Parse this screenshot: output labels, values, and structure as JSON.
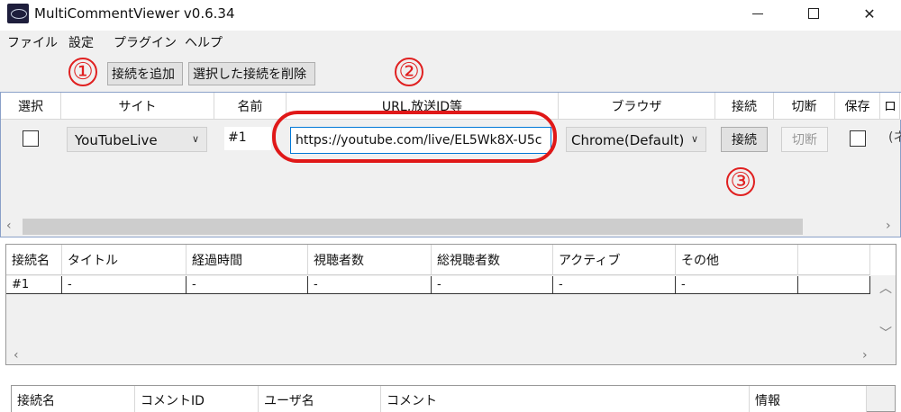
{
  "window": {
    "title": "MultiCommentViewer v0.6.34",
    "controls": {
      "minimize": "—",
      "maximize": "☐",
      "close": "✕"
    }
  },
  "menu": [
    "ファイル",
    "設定",
    "プラグイン",
    "ヘルプ"
  ],
  "toolbar": {
    "add_connection": "接続を追加",
    "delete_connection": "選択した接続を削除"
  },
  "annotations": [
    "①",
    "②",
    "③"
  ],
  "connections": {
    "headers": [
      "選択",
      "サイト",
      "名前",
      "URL,放送ID等",
      "ブラウザ",
      "接続",
      "切断",
      "保存",
      "ロ"
    ],
    "row": {
      "site": "YouTubeLive",
      "name": "#1",
      "url": "https://youtube.com/live/EL5Wk8X-U5c",
      "browser": "Chrome(Default)",
      "connect": "接続",
      "disconnect": "切断",
      "extra": "(ネ"
    }
  },
  "stats": {
    "headers": [
      "接続名",
      "タイトル",
      "経過時間",
      "視聴者数",
      "総視聴者数",
      "アクティブ",
      "その他"
    ],
    "row": [
      "#1",
      "-",
      "-",
      "-",
      "-",
      "-",
      "-"
    ]
  },
  "comments": {
    "headers": [
      "接続名",
      "コメントID",
      "ユーザ名",
      "コメント",
      "情報"
    ]
  },
  "icons": {
    "dropdown": "chevron-down-icon",
    "scroll_left": "‹",
    "scroll_right": "›",
    "scroll_up": "︿",
    "scroll_down": "﹀"
  }
}
